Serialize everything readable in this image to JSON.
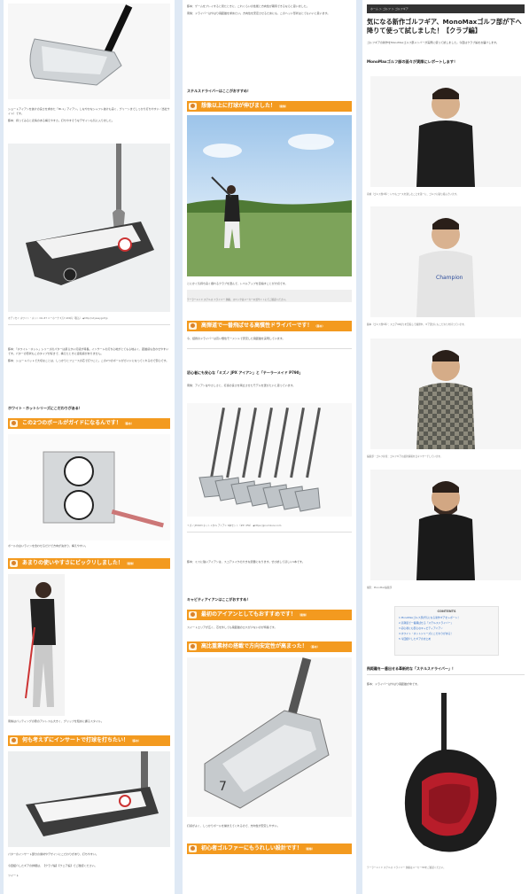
{
  "col1": {
    "para1": "ショートアイアンを抜けの良さを求めた「MI-1」アイアン。しなやかなシャフト抜けも良く、グリーンまでしっかり打ちやすい（当社サイト）です。",
    "para2": "藤本：持ってみると表情のある構えやすさ。打ちやすそうなデザインも気に入りました。",
    "credit": "オデッセイ ホワイト・ホット OG #7 ニーホーク 3万7,400円（税込） ◆http://odysseygolf.jp",
    "para3": "藤本：「ホワイト・ホット」シリーズのパターは柔らかい打感が特長。インサートの打ち心地がとても心地よく、距離感も合わせやすいです。パターの形状もこのタイプが好きで、構えたときに違和感がありません。",
    "para4": "藤本：ショートパットで大切なことは、しっかりとフェースの芯で打つこと。この2つのボールがガイドになってくれるので安心です。",
    "sub1": "ホワイト・ホットシリーズにこだわりがある！",
    "bar1": "この2つのボールがガイドになるんです！",
    "bar1_tag": "（藤本）",
    "caption1": "ボールの白いラインを合わせるだけで方向が決まり、構えやすい。",
    "bar2": "あまりの使いやすさにビックリしました！",
    "bar2_tag": "（南條）",
    "caption2": "南條はパッティングの際のアドレスも大きく、グリップを短めに握るスタイル。",
    "bar3": "何も考えずにインサートで打球を打ちたい！",
    "bar3_tag": "（藤本）",
    "caption3": "パターのインサート部分の素材やデザインにこだわりがあり、打ちやすい。",
    "footer": "今回紹介したギアの詳細は、【クラブ編】【ウェア編】でご確認ください。",
    "tiny": "ツイート"
  },
  "col2": {
    "para1": "藤本：ゲームをプレイすると見たときに、これくらいの性能と方向性が期待できるならと思いました。",
    "para2": "南條：ドライバーはやはり飛距離を求めたい。方向性を安定させるためにも、このヘッド形状はとてもいいと思います。",
    "sub1": "ステルスドライバーはここがおすすめ！",
    "bar1": "想像以上に打球が伸びました！",
    "bar1_tag": "（南條）",
    "caption1": "とにかく気持ち良く振れるクラブを選んで、レベルアップを目指すことが大切です。",
    "note1": "テーラーメイド ステルス ドライバー 価格、スペックはメーカー公式サイトにてご確認ください。",
    "bar2": "高弾道で一番飛ばせる高慣性ドライバーです！",
    "bar2_tag": "（藤本）",
    "para3": "今、話題のドライバーは高い慣性モーメントで安定した飛距離を実現しています。",
    "sub2": "初心者にも安心な「ミズノ JPX アイアン」と「テーラーメイド P790」",
    "para4": "南條：アイアンはやさしさと、打感の良さを両立させたモデルを選びたいと思っています。",
    "credit": "ミズノ JPX923 ホットメタル アイアン 6本セット（#5～PW） ◆https://jpn.mizuno.com",
    "para5": "藤本：ミスに強いアイアンは、スコアメイクの大きな武器になります。ぜひ試してほしい1本です。",
    "sub3": "キャビティアイアンはここがおすすめ！",
    "bar3": "最初のアイアンとしてもおすすめです！",
    "bar3_tag": "（南條）",
    "para6": "スイートエリアが広く、芯を外しても飛距離のロスが少ないのが特長です。",
    "bar4": "高比重素材の搭載で方向安定性が高まった！",
    "bar4_tag": "（藤本）",
    "caption2": "打感がよく、しっかりボールを捕まえてくれるので、方向性が安定しやすい。",
    "bar5": "初心者ゴルファーにもうれしい設計です！",
    "bar5_tag": "（南條）"
  },
  "col3": {
    "breadcrumb": "ホーム ＞ ゴルフ ＞ ゴルフギア",
    "title": "気になる新作ゴルフギア、MonoMaxゴルフ部が下へ降りて使って試しました！【クラブ編】",
    "intro": "ゴルフギアの新作をMonoMaxゴルフ部メンバーが実際に使って試しました。今回はクラブ編をお届けします。",
    "lead": "MonoMaxゴルフ部の面々が実際にレポートします！",
    "cap1": "南條（ゴルフ歴3年）：いつもコースを楽しむことを第一に、ゴルフに取り組んでいます。",
    "cap2": "藤本（ゴルフ歴5年）：スコア90切りを目指して練習中。ギア選びにもこだわりを持っています。",
    "cap3": "編集部・ゴルフ担当：ゴルフギアの最新情報を日々リサーチしています。",
    "cap4": "撮影：MonoMax編集部",
    "toc_title": "CONTENTS",
    "toc": [
      "1 MonoMaxゴルフ部が気になる新作ギアをレポート！",
      "2 高弾道で一番飛ばせる「ステルスドライバー」",
      "3 初心者にも安心なキャビティアイアン",
      "4 ホワイト・ホットシリーズにこだわりがある！",
      "5 今回紹介したギアのまとめ"
    ],
    "sub1": "飛距離を一番出せる革新的な「ステルスドライバー」！",
    "para1": "藤本：ドライバーはやはり飛距離が命です。",
    "credit": "テーラーメイド ステルス ドライバー 価格はメーカーHPをご確認ください。"
  }
}
